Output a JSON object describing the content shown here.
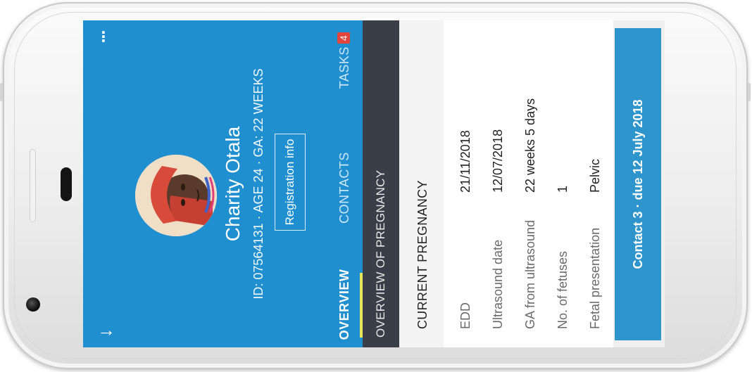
{
  "header": {
    "patient_name": "Charity Otala",
    "patient_meta": "ID: 07564131  ·  AGE 24  ·  GA: 22 WEEKS",
    "registration_button": "Registration info"
  },
  "tabs": [
    {
      "label": "OVERVIEW"
    },
    {
      "label": "CONTACTS"
    },
    {
      "label": "TASKS",
      "badge": "4"
    }
  ],
  "section": {
    "title": "OVERVIEW OF PREGNANCY"
  },
  "card": {
    "title": "CURRENT PREGNANCY",
    "rows": [
      {
        "label": "EDD",
        "value": "21/11/2018"
      },
      {
        "label": "Ultrasound date",
        "value": "12/07/2018"
      },
      {
        "label": "GA from ultrasound",
        "value": "22 weeks 5 days"
      },
      {
        "label": "No. of fetuses",
        "value": "1"
      },
      {
        "label": "Fetal presentation",
        "value": "Pelvic"
      }
    ]
  },
  "cta": {
    "label": "Contact 3 · due 12 July 2018"
  },
  "icons": {
    "back": "arrow-down-icon",
    "menu": "more-vertical-icon"
  },
  "colors": {
    "header": "#1f8fd0",
    "section_bar": "#3a3e48",
    "tab_underline": "#e8e75a",
    "badge": "#e2453c",
    "cta": "#2e95cc"
  }
}
